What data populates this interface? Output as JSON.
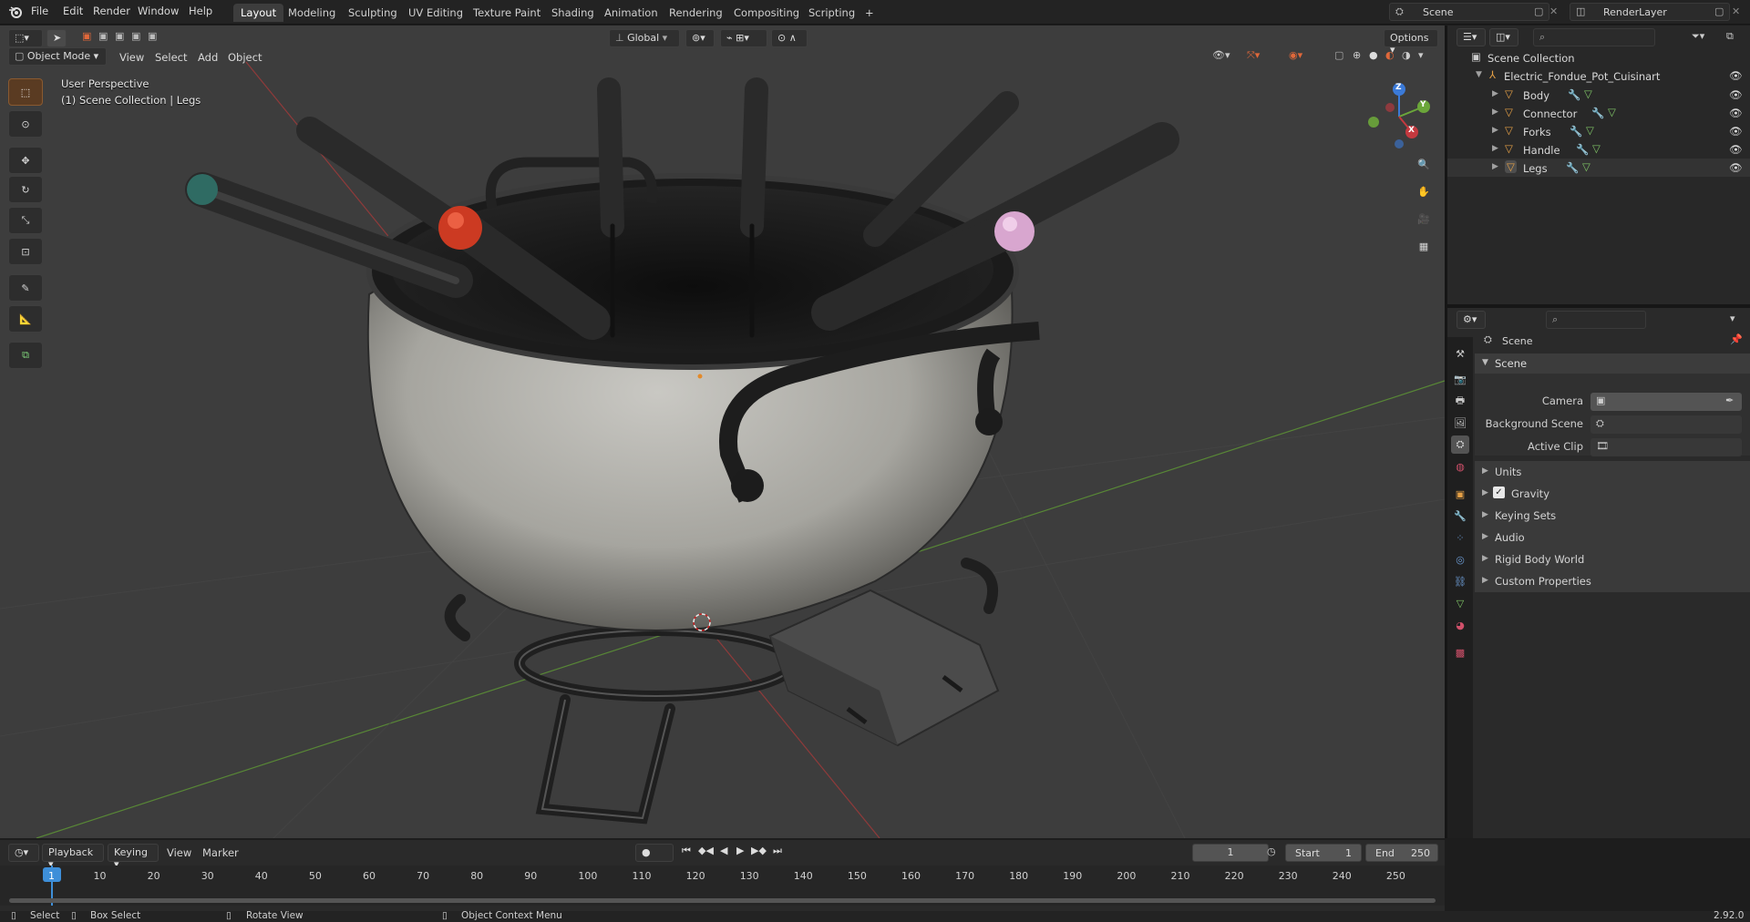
{
  "topbar": {
    "menus": [
      "File",
      "Edit",
      "Render",
      "Window",
      "Help"
    ],
    "workspaces": [
      "Layout",
      "Modeling",
      "Sculpting",
      "UV Editing",
      "Texture Paint",
      "Shading",
      "Animation",
      "Rendering",
      "Compositing",
      "Scripting"
    ],
    "active_workspace": "Layout",
    "add_tab": "+",
    "scene": "Scene",
    "view_layer": "RenderLayer"
  },
  "viewport": {
    "mode": "Object Mode",
    "menus": [
      "View",
      "Select",
      "Add",
      "Object"
    ],
    "orientation": "Global",
    "options": "Options",
    "perspective": "User Perspective",
    "collection_info": "(1) Scene Collection | Legs",
    "gizmo": {
      "z": "Z",
      "y": "Y",
      "x": "X"
    }
  },
  "outliner": {
    "root": "Scene Collection",
    "collection": "Electric_Fondue_Pot_Cuisinart",
    "objects": [
      "Body",
      "Connector",
      "Forks",
      "Handle",
      "Legs"
    ]
  },
  "properties": {
    "context": "Scene",
    "panel_title": "Scene",
    "fields": {
      "camera": "Camera",
      "background_scene": "Background Scene",
      "active_clip": "Active Clip"
    },
    "subpanels": [
      "Units",
      "Gravity",
      "Keying Sets",
      "Audio",
      "Rigid Body World",
      "Custom Properties"
    ],
    "gravity_checked": true
  },
  "timeline": {
    "menus": [
      "Playback",
      "Keying",
      "View",
      "Marker"
    ],
    "current_frame": "1",
    "start_label": "Start",
    "start": "1",
    "end_label": "End",
    "end": "250",
    "ticks": [
      "1",
      "10",
      "20",
      "30",
      "40",
      "50",
      "60",
      "70",
      "80",
      "90",
      "100",
      "110",
      "120",
      "130",
      "140",
      "150",
      "160",
      "170",
      "180",
      "190",
      "200",
      "210",
      "220",
      "230",
      "240",
      "250"
    ]
  },
  "statusbar": {
    "select": "Select",
    "box_select": "Box Select",
    "rotate": "Rotate View",
    "context_menu": "Object Context Menu",
    "version": "2.92.0"
  },
  "colors": {
    "accent": "#e2762a",
    "x_axis": "#c4393f",
    "y_axis": "#6ba63a",
    "z_axis": "#3b7ad8"
  }
}
